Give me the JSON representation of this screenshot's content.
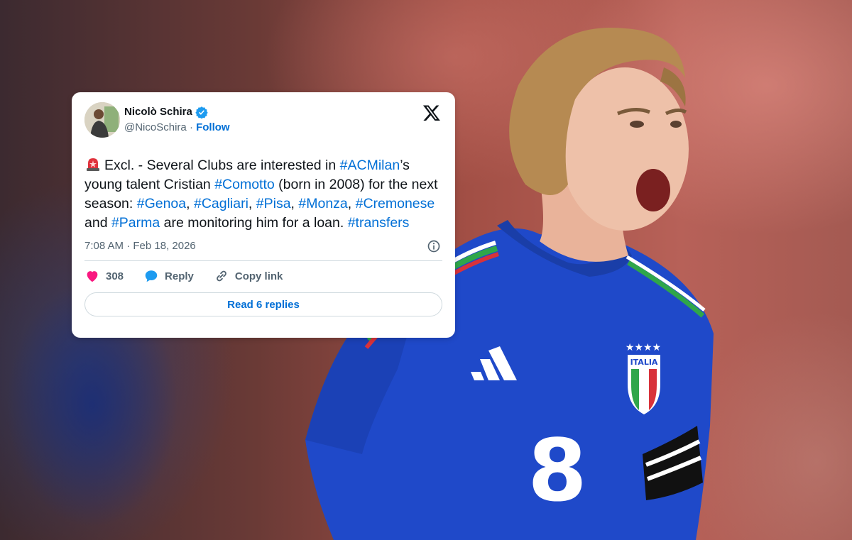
{
  "tweet": {
    "display_name": "Nicolò Schira",
    "handle": "@NicoSchira",
    "separator": "·",
    "follow_label": "Follow",
    "body": {
      "p1": "Excl. - Several Clubs are interested in ",
      "t1": "#ACMilan",
      "p2": "’s young talent Cristian ",
      "t2": "#Comotto",
      "p3": " (born in 2008) for the next season: ",
      "t3": "#Genoa",
      "p4": ", ",
      "t4": "#Cagliari",
      "p5": ", ",
      "t5": "#Pisa",
      "p6": ", ",
      "t6": "#Monza",
      "p7": ", ",
      "t7": "#Cremonese",
      "p8": " and ",
      "t8": "#Parma",
      "p9": " are monitoring him for a loan. ",
      "t9": "#transfers"
    },
    "timestamp": "7:08 AM · Feb 18, 2026",
    "likes": "308",
    "reply_label": "Reply",
    "copy_label": "Copy link",
    "read_replies_label": "Read 6 replies"
  },
  "photo": {
    "jersey_number": "8",
    "crest_text": "ITALIA"
  },
  "colors": {
    "link": "#006fd6",
    "verified": "#1d9bf0",
    "like": "#f91880",
    "jersey": "#1f49c9"
  },
  "icons": [
    "x-logo-icon",
    "verified-badge-icon",
    "siren-icon",
    "info-icon",
    "heart-icon",
    "reply-icon",
    "link-icon"
  ]
}
